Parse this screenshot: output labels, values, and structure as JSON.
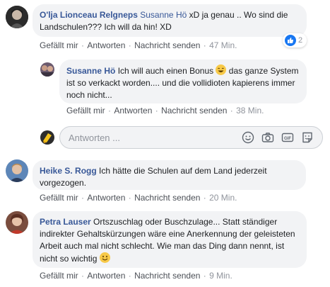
{
  "comments": [
    {
      "author": "O'lja Lionceau Relgneps",
      "mention": "Susanne Hö",
      "text": " xD ja genau .. Wo sind die Landschulen??? Ich will da hin! XD",
      "reaction_count": "2",
      "like_label": "Gefällt mir",
      "reply_label": "Antworten",
      "message_label": "Nachricht senden",
      "time": "47 Min."
    },
    {
      "author": "Heike S. Rogg",
      "text": "Ich hätte die Schulen auf dem Land jederzeit vorgezogen.",
      "like_label": "Gefällt mir",
      "reply_label": "Antworten",
      "message_label": "Nachricht senden",
      "time": "20 Min."
    },
    {
      "author": "Petra Lauser",
      "text": "Ortszuschlag oder Buschzulage... Statt ständiger indirekter Gehaltskürzungen wäre eine Anerkennung der geleisteten Arbeit auch mal nicht schlecht. Wie man das Ding dann nennt, ist nicht so wichtig",
      "like_label": "Gefällt mir",
      "reply_label": "Antworten",
      "message_label": "Nachricht senden",
      "time": "9 Min."
    }
  ],
  "reply": {
    "author": "Susanne Hö",
    "text": "Ich will auch einen Bonus",
    "text2": " das ganze System ist so verkackt worden.... und die vollidioten kapierens immer noch nicht...",
    "like_label": "Gefällt mir",
    "reply_label": "Antworten",
    "message_label": "Nachricht senden",
    "time": "38 Min."
  },
  "reply_box": {
    "placeholder": "Antworten ..."
  },
  "colors": {
    "link": "#385898",
    "bubble": "#f2f3f5",
    "like_blue": "#1877f2"
  }
}
